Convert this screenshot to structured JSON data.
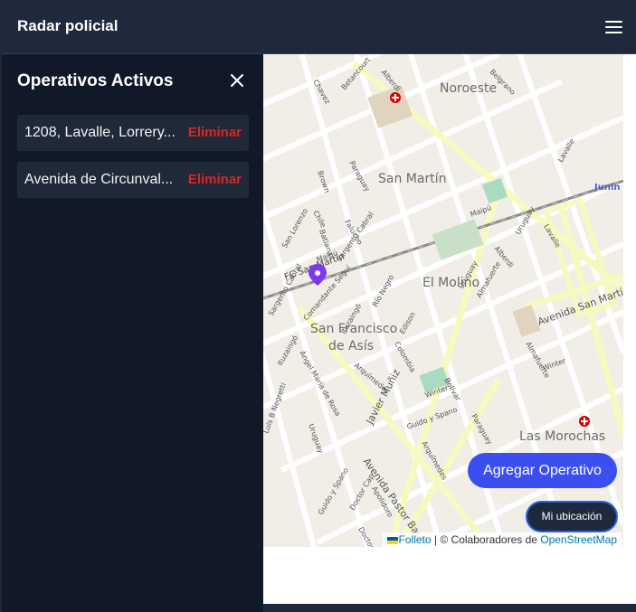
{
  "header": {
    "title": "Radar policial",
    "menu_icon": "hamburger-icon"
  },
  "sidebar": {
    "heading": "Operativos Activos",
    "close_icon": "close-icon",
    "items": [
      {
        "address": "1208, Lavalle, Lorrery...",
        "delete_label": "Eliminar"
      },
      {
        "address": "Avenida de Circunval...",
        "delete_label": "Eliminar"
      }
    ]
  },
  "map": {
    "labels": {
      "noroeste": "Noroeste",
      "san_martin": "San Martín",
      "el_molino": "El Molino",
      "san_francisco_1": "San Francisco",
      "san_francisco_2": "de Asís",
      "las_morochas": "Las Morochas",
      "junin": "Junín",
      "av_san_martin": "Avenida San Martín",
      "av_pastor_bauman": "Avenida Pastor Bauman",
      "javier_muniz": "Javier Muñiz",
      "fc_san_martin": "FC San Martín",
      "maipu": "Maipú",
      "alberdi": "Alberdi",
      "uruguay": "Uruguay",
      "belgrano": "Belgrano",
      "colombia": "Colombia",
      "bolivar": "Bolívar",
      "winter": "Winter",
      "chile": "Chile",
      "paraguay": "Paraguay",
      "lavalle": "Lavalle",
      "rio_negro": "Río Negro",
      "edison": "Edison",
      "comandante_segui": "Comandante Seguí",
      "sargento_cabral": "Sargento Cabral",
      "ituzaingo": "Ituzaingó",
      "arquimedes": "Arquímedes",
      "angel_maria_de_rosa": "Ángel María de Rosa",
      "luis_negretti": "Luis B Negretti",
      "guido_y_spano": "Guido y Spano",
      "doctor_cap": "Doctor Cap",
      "doctor_rosa": "Doctor Rosa",
      "apolidoro": "Apolidoro",
      "almafuerte": "Almafuerte",
      "betancourt": "Betancourt",
      "falucho": "Falucho",
      "san_lorenzo": "San Lorenzo",
      "batiana": "Batiana",
      "chavez": "Chavez",
      "brown": "Brown"
    },
    "add_button": "Agregar Operativo",
    "location_button": "Mi ubicación",
    "attribution": {
      "leaflet": "Folleto",
      "separator": " | © Colaboradores de ",
      "osm": "OpenStreetMap"
    }
  },
  "colors": {
    "header_bg": "#1e293b",
    "sidebar_bg": "#111827",
    "item_bg": "#1f2937",
    "delete": "#dc2626",
    "primary": "#3b4ef0",
    "marker": "#7c3aed"
  }
}
